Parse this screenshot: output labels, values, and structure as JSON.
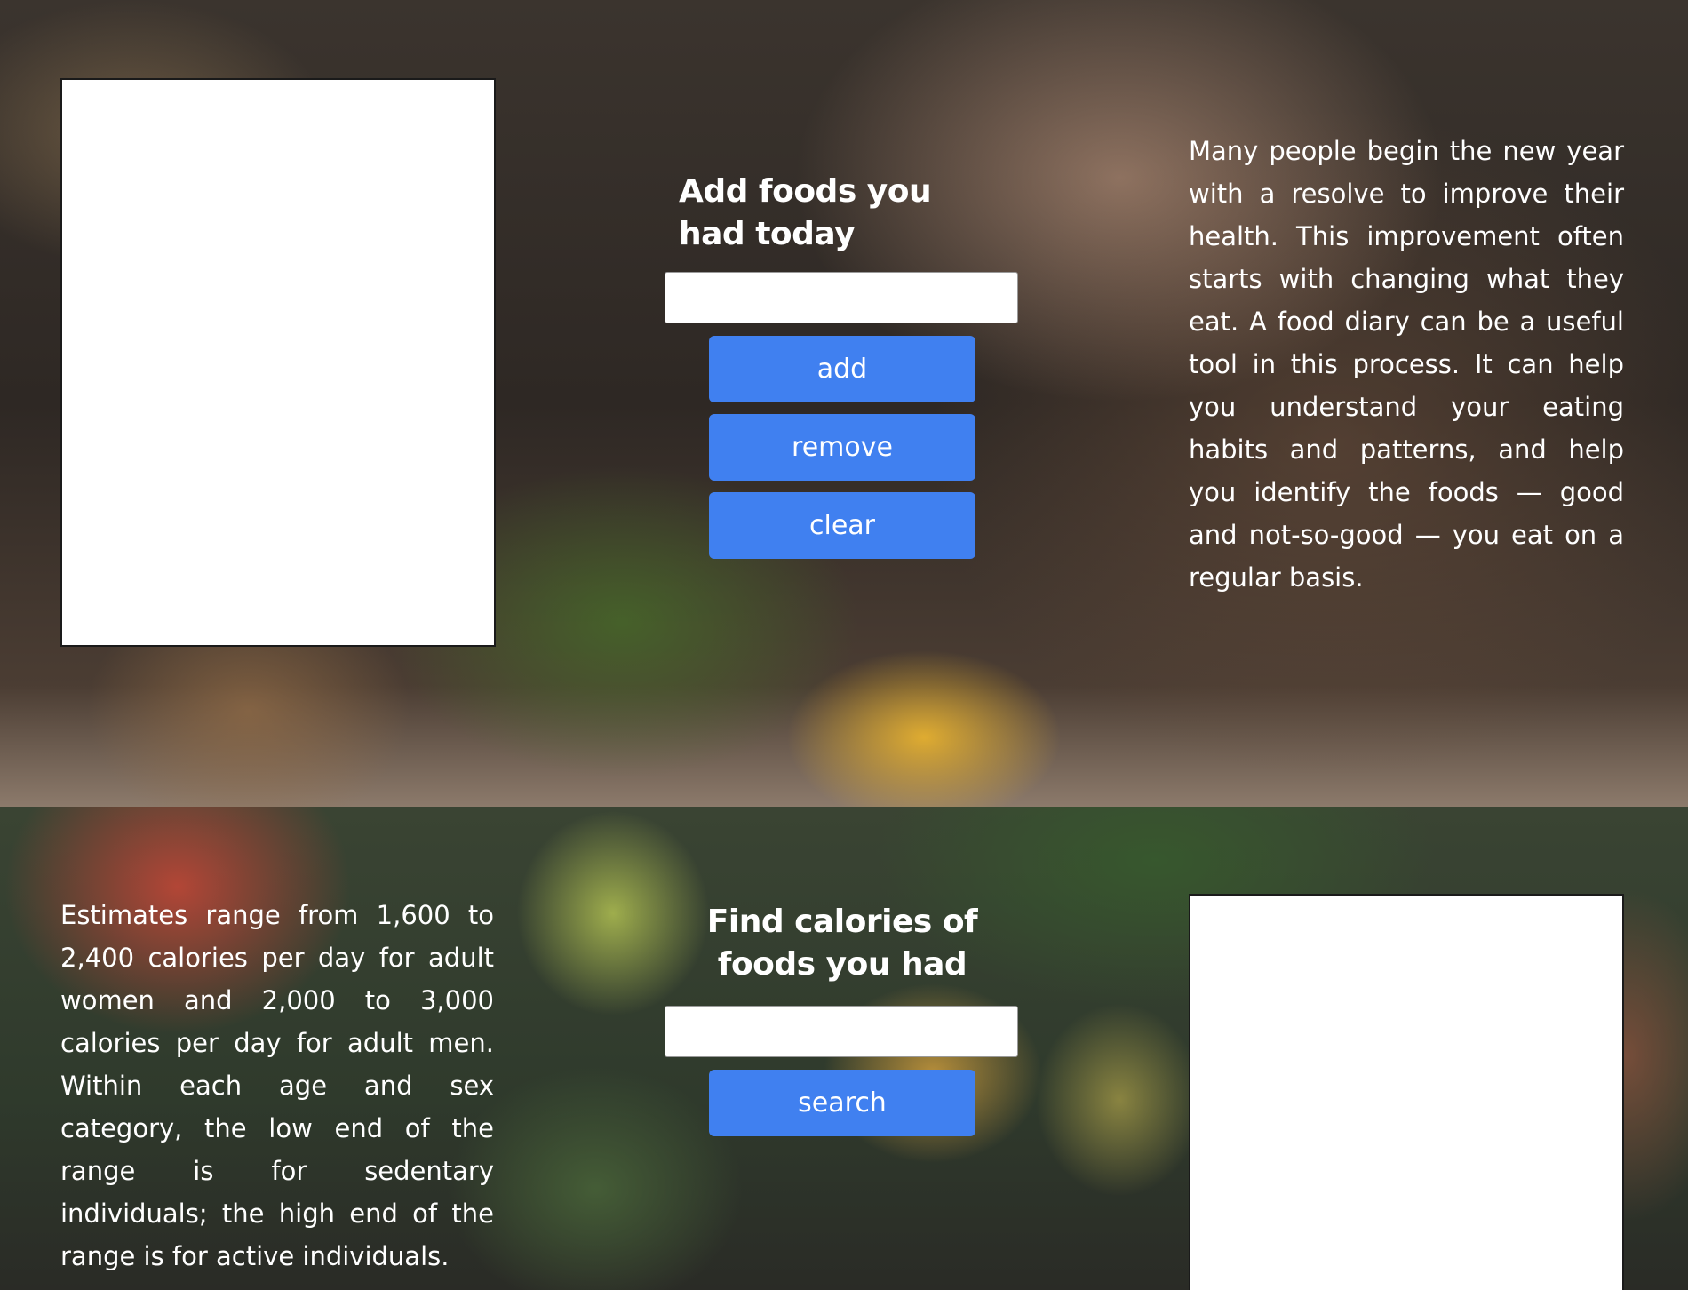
{
  "diary": {
    "heading": "Add foods you had today",
    "input_value": "",
    "add_label": "add",
    "remove_label": "remove",
    "clear_label": "clear",
    "intro_text": "Many people begin the new year with a resolve to improve their health. This improvement often starts with changing what they eat. A food diary can be a useful tool in this process. It can help you understand your eating habits and patterns, and help you identify the foods — good and not-so-good — you eat on a regular basis."
  },
  "calories": {
    "heading": "Find calories of foods you had",
    "input_value": "",
    "search_label": "search",
    "info_text": "Estimates range from 1,600 to 2,400 calories per day for adult women and 2,000 to 3,000 calories per day for adult men. Within each age and sex category, the low end of the range is for sedentary individuals; the high end of the range is for active individuals."
  }
}
